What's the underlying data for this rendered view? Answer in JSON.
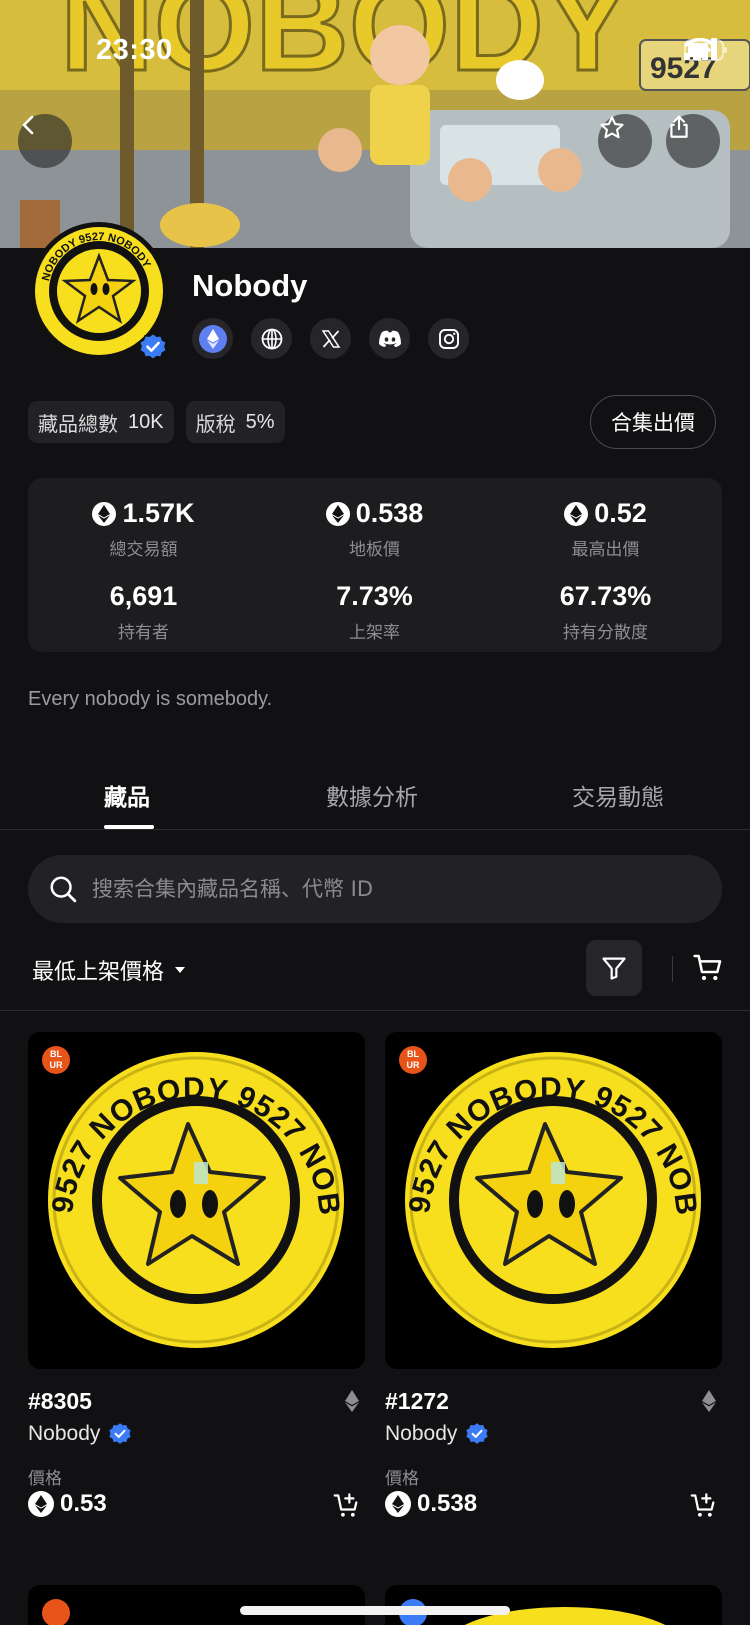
{
  "status_bar": {
    "time": "23:30"
  },
  "banner": {
    "plate_text": "9527"
  },
  "collection": {
    "name": "Nobody",
    "avatar_text": "NOBODY 9527",
    "verified": true,
    "socials": [
      "ethereum-icon",
      "globe-icon",
      "x-icon",
      "discord-icon",
      "instagram-icon"
    ]
  },
  "chips": [
    {
      "label": "藏品總數",
      "value": "10K"
    },
    {
      "label": "版稅",
      "value": "5%"
    }
  ],
  "offer_button": "合集出價",
  "stats": [
    {
      "value": "1.57K",
      "label": "總交易額",
      "eth": true
    },
    {
      "value": "0.538",
      "label": "地板價",
      "eth": true
    },
    {
      "value": "0.52",
      "label": "最高出價",
      "eth": true
    },
    {
      "value": "6,691",
      "label": "持有者",
      "eth": false
    },
    {
      "value": "7.73%",
      "label": "上架率",
      "eth": false
    },
    {
      "value": "67.73%",
      "label": "持有分散度",
      "eth": false
    }
  ],
  "description": "Every nobody is somebody.",
  "tabs": [
    {
      "label": "藏品",
      "active": true
    },
    {
      "label": "數據分析",
      "active": false
    },
    {
      "label": "交易動態",
      "active": false
    }
  ],
  "search": {
    "placeholder": "搜索合集內藏品名稱、代幣 ID"
  },
  "sort": {
    "label": "最低上架價格"
  },
  "nfts": [
    {
      "token": "#8305",
      "collection": "Nobody",
      "price_label": "價格",
      "price": "0.53",
      "marketplace": "BLUR"
    },
    {
      "token": "#1272",
      "collection": "Nobody",
      "price_label": "價格",
      "price": "0.538",
      "marketplace": "BLUR"
    }
  ],
  "colors": {
    "background": "#111113",
    "card": "#1d1d20",
    "verified": "#3b7bf5",
    "seal_yellow": "#f7df1e",
    "blur_orange": "#e8531a"
  }
}
